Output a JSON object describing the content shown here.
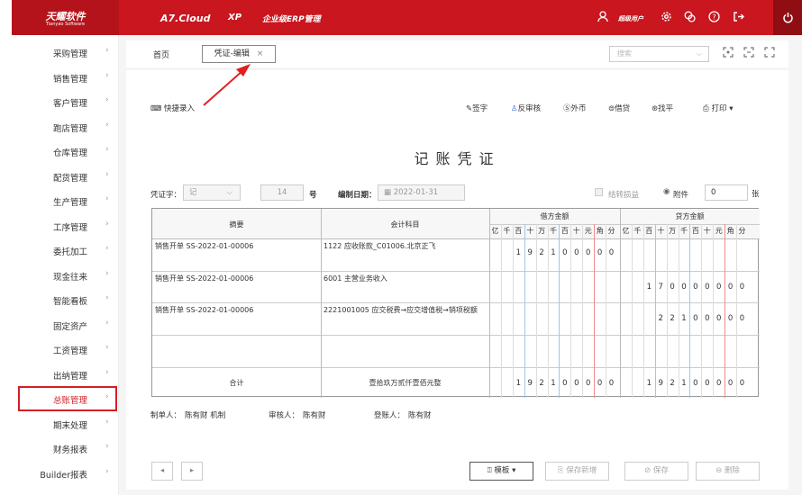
{
  "topbar": {
    "logo_main": "天耀软件",
    "logo_sub": "Tianyao Software",
    "product": "A7.Cloud",
    "edition": "XP",
    "suite": "企业级ERP管理",
    "user": "超级用户"
  },
  "sidebar": {
    "items": [
      "采购管理",
      "销售管理",
      "客户管理",
      "跑店管理",
      "仓库管理",
      "配货管理",
      "生产管理",
      "工序管理",
      "委托加工",
      "现金往来",
      "智能看板",
      "固定资产",
      "工资管理",
      "出纳管理",
      "总账管理",
      "期末处理",
      "财务报表",
      "Builder报表"
    ],
    "selected": "总账管理"
  },
  "tabs": {
    "home": "首页",
    "active": "凭证-编辑"
  },
  "search": {
    "placeholder": "搜索"
  },
  "toolbar": {
    "quick_entry": "快捷录入",
    "sign": "签字",
    "unaudit": "反审核",
    "foreign": "外币",
    "borrow": "借贷",
    "balance": "找平",
    "print": "打印"
  },
  "voucher": {
    "title": "记账凭证",
    "word_label": "凭证字：",
    "word_value": "记",
    "number_value": "14",
    "number_suffix": "号",
    "date_label": "编制日期：",
    "date_value": "2022-01-31",
    "carry_label": "结转损益",
    "attach_label": "附件",
    "attach_value": "0",
    "attach_suffix": "张",
    "headers": {
      "summary": "摘要",
      "account": "会计科目",
      "debit": "借方金额",
      "credit": "贷方金额"
    },
    "digit_units": [
      "亿",
      "千",
      "百",
      "十",
      "万",
      "千",
      "百",
      "十",
      "元",
      "角",
      "分"
    ],
    "rows": [
      {
        "summary": "销售开单 SS-2022-01-00006",
        "account": "1122 应收账款_C01006.北京正飞",
        "debit": "192100000",
        "credit": ""
      },
      {
        "summary": "销售开单 SS-2022-01-00006",
        "account": "6001 主营业务收入",
        "debit": "",
        "credit": "170000000"
      },
      {
        "summary": "销售开单 SS-2022-01-00006",
        "account": "2221001005 应交税费→应交增值税→销项税额",
        "debit": "",
        "credit": "22100000"
      },
      {
        "summary": "",
        "account": "",
        "debit": "",
        "credit": ""
      }
    ],
    "total": {
      "label": "合计",
      "amount_text": "壹拾玖万贰仟壹佰元整",
      "debit": "192100000",
      "credit": "192100000"
    }
  },
  "signatures": {
    "maker_label": "制单人：",
    "maker": "陈有财 机制",
    "auditor_label": "审核人：",
    "auditor": "陈有财",
    "poster_label": "登账人：",
    "poster": "陈有财"
  },
  "bottom": {
    "template": "模板",
    "save_new": "保存新增",
    "save": "保存",
    "delete": "删除"
  }
}
